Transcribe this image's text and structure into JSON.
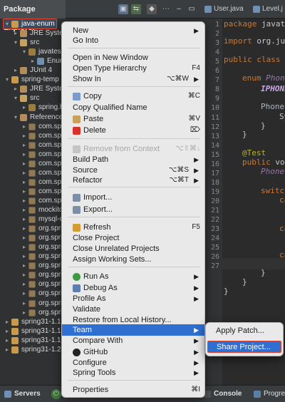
{
  "explorer": {
    "tab_label": "Package Explorer",
    "tree": [
      {
        "label": "java-enum",
        "indent": 0,
        "twisty": "▾",
        "icon": "project-icon",
        "selected": true
      },
      {
        "label": "JRE System",
        "indent": 1,
        "twisty": "▸",
        "icon": "library-icon"
      },
      {
        "label": "src",
        "indent": 1,
        "twisty": "▾",
        "icon": "source-folder-icon"
      },
      {
        "label": "javates",
        "indent": 2,
        "twisty": "▾",
        "icon": "package-icon"
      },
      {
        "label": "Enur",
        "indent": 3,
        "twisty": "▸",
        "icon": "java-file-icon"
      },
      {
        "label": "JUnit 4",
        "indent": 1,
        "twisty": "▸",
        "icon": "library-icon"
      },
      {
        "label": "spring-temp",
        "indent": 0,
        "twisty": "▾",
        "icon": "project-icon"
      },
      {
        "label": "JRE Syster",
        "indent": 1,
        "twisty": "▸",
        "icon": "library-icon"
      },
      {
        "label": "src",
        "indent": 1,
        "twisty": "▾",
        "icon": "source-folder-icon"
      },
      {
        "label": "spring.h",
        "indent": 2,
        "twisty": "▸",
        "icon": "package-icon"
      },
      {
        "label": "Referenced",
        "indent": 1,
        "twisty": "▾",
        "icon": "library-icon"
      },
      {
        "label": "com.sp",
        "indent": 2,
        "twisty": "▸",
        "icon": "jar-icon"
      },
      {
        "label": "com.sp",
        "indent": 2,
        "twisty": "▸",
        "icon": "jar-icon"
      },
      {
        "label": "com.sp",
        "indent": 2,
        "twisty": "▸",
        "icon": "jar-icon"
      },
      {
        "label": "com.sp",
        "indent": 2,
        "twisty": "▸",
        "icon": "jar-icon"
      },
      {
        "label": "com.sp",
        "indent": 2,
        "twisty": "▸",
        "icon": "jar-icon"
      },
      {
        "label": "com.sp",
        "indent": 2,
        "twisty": "▸",
        "icon": "jar-icon"
      },
      {
        "label": "com.sp",
        "indent": 2,
        "twisty": "▸",
        "icon": "jar-icon"
      },
      {
        "label": "com.sp",
        "indent": 2,
        "twisty": "▸",
        "icon": "jar-icon"
      },
      {
        "label": "com.sp",
        "indent": 2,
        "twisty": "▸",
        "icon": "jar-icon"
      },
      {
        "label": "mockito",
        "indent": 2,
        "twisty": "▸",
        "icon": "jar-icon"
      },
      {
        "label": "mysql-c",
        "indent": 2,
        "twisty": "▸",
        "icon": "jar-icon"
      },
      {
        "label": "org.spri",
        "indent": 2,
        "twisty": "▸",
        "icon": "jar-icon"
      },
      {
        "label": "org.spri",
        "indent": 2,
        "twisty": "▸",
        "icon": "jar-icon"
      },
      {
        "label": "org.spri",
        "indent": 2,
        "twisty": "▸",
        "icon": "jar-icon"
      },
      {
        "label": "org.spri",
        "indent": 2,
        "twisty": "▸",
        "icon": "jar-icon"
      },
      {
        "label": "org.spri",
        "indent": 2,
        "twisty": "▸",
        "icon": "jar-icon"
      },
      {
        "label": "org.spri",
        "indent": 2,
        "twisty": "▸",
        "icon": "jar-icon"
      },
      {
        "label": "org.spri",
        "indent": 2,
        "twisty": "▸",
        "icon": "jar-icon"
      },
      {
        "label": "org.spri",
        "indent": 2,
        "twisty": "▸",
        "icon": "jar-icon"
      },
      {
        "label": "org.spri",
        "indent": 2,
        "twisty": "▸",
        "icon": "jar-icon"
      },
      {
        "label": "org.spri",
        "indent": 2,
        "twisty": "▸",
        "icon": "jar-icon"
      },
      {
        "label": "spring31-1.1",
        "indent": 0,
        "twisty": "▸",
        "icon": "project-icon"
      },
      {
        "label": "spring31-1.1",
        "indent": 0,
        "twisty": "▸",
        "icon": "project-icon"
      },
      {
        "label": "spring31-1.1",
        "indent": 0,
        "twisty": "▸",
        "icon": "project-icon"
      },
      {
        "label": "spring31-1.2",
        "indent": 0,
        "twisty": "▸",
        "icon": "project-icon"
      }
    ]
  },
  "editor": {
    "tabs": [
      "User.java",
      "Level.j"
    ],
    "line_numbers": [
      "1",
      "2",
      "3",
      "4",
      "5",
      "6",
      "7",
      "8",
      "9",
      "10",
      "11",
      "12",
      "13",
      "14",
      "15",
      "16",
      "17",
      "18",
      "19",
      "20",
      "21",
      "22",
      "23",
      "24",
      "25",
      "26",
      "27"
    ],
    "code": {
      "l1_kw": "package",
      "l1_rest": " javate",
      "l3_kw": "import",
      "l3_rest": " org.ju",
      "l5_kw": "public class",
      "l5_rest": " E",
      "l7_kw": "enum",
      "l7_rest": " Phone",
      "l8": "IPHONE",
      "l10": "Phone",
      "l11": "Sy",
      "l12": "}",
      "l13": "}",
      "l15": "@Test",
      "l16_kw": "public",
      "l16_rest": " vo",
      "l17": "Phone",
      "l19": "switc",
      "l20": "ca",
      "l22": "ca",
      "l24": "ca",
      "l26": "}",
      "l27": "}",
      "l28": "}"
    }
  },
  "bottom": {
    "servers_label": "Servers",
    "console_label": "Console",
    "progress_label": "Progre"
  },
  "context_menu": {
    "items": [
      {
        "label": "New",
        "shortcut": "",
        "arrow": "▶"
      },
      {
        "label": "Go Into",
        "shortcut": "",
        "arrow": ""
      },
      {
        "label": "Open in New Window",
        "shortcut": "",
        "arrow": ""
      },
      {
        "label": "Open Type Hierarchy",
        "shortcut": "F4",
        "arrow": ""
      },
      {
        "label": "Show In",
        "shortcut": "⌥⌘W",
        "arrow": "▶"
      },
      {
        "label": "Copy",
        "shortcut": "⌘C",
        "arrow": ""
      },
      {
        "label": "Copy Qualified Name",
        "shortcut": "",
        "arrow": ""
      },
      {
        "label": "Paste",
        "shortcut": "⌘V",
        "arrow": ""
      },
      {
        "label": "Delete",
        "shortcut": "⌦",
        "arrow": ""
      },
      {
        "label": "Remove from Context",
        "shortcut": "⌥⇧⌘↓",
        "arrow": ""
      },
      {
        "label": "Build Path",
        "shortcut": "",
        "arrow": "▶"
      },
      {
        "label": "Source",
        "shortcut": "⌥⌘S",
        "arrow": "▶"
      },
      {
        "label": "Refactor",
        "shortcut": "⌥⌘T",
        "arrow": "▶"
      },
      {
        "label": "Import...",
        "shortcut": "",
        "arrow": ""
      },
      {
        "label": "Export...",
        "shortcut": "",
        "arrow": ""
      },
      {
        "label": "Refresh",
        "shortcut": "F5",
        "arrow": ""
      },
      {
        "label": "Close Project",
        "shortcut": "",
        "arrow": ""
      },
      {
        "label": "Close Unrelated Projects",
        "shortcut": "",
        "arrow": ""
      },
      {
        "label": "Assign Working Sets...",
        "shortcut": "",
        "arrow": ""
      },
      {
        "label": "Run As",
        "shortcut": "",
        "arrow": "▶"
      },
      {
        "label": "Debug As",
        "shortcut": "",
        "arrow": "▶"
      },
      {
        "label": "Profile As",
        "shortcut": "",
        "arrow": "▶"
      },
      {
        "label": "Validate",
        "shortcut": "",
        "arrow": ""
      },
      {
        "label": "Restore from Local History...",
        "shortcut": "",
        "arrow": ""
      },
      {
        "label": "Team",
        "shortcut": "",
        "arrow": "▶"
      },
      {
        "label": "Compare With",
        "shortcut": "",
        "arrow": "▶"
      },
      {
        "label": "GitHub",
        "shortcut": "",
        "arrow": "▶"
      },
      {
        "label": "Configure",
        "shortcut": "",
        "arrow": "▶"
      },
      {
        "label": "Spring Tools",
        "shortcut": "",
        "arrow": "▶"
      },
      {
        "label": "Properties",
        "shortcut": "⌘I",
        "arrow": ""
      }
    ]
  },
  "team_submenu": {
    "items": [
      "Apply Patch...",
      "Share Project..."
    ]
  },
  "colors": {
    "menu_highlight": "#2f6fd1",
    "annotation_red": "#e0442f"
  }
}
